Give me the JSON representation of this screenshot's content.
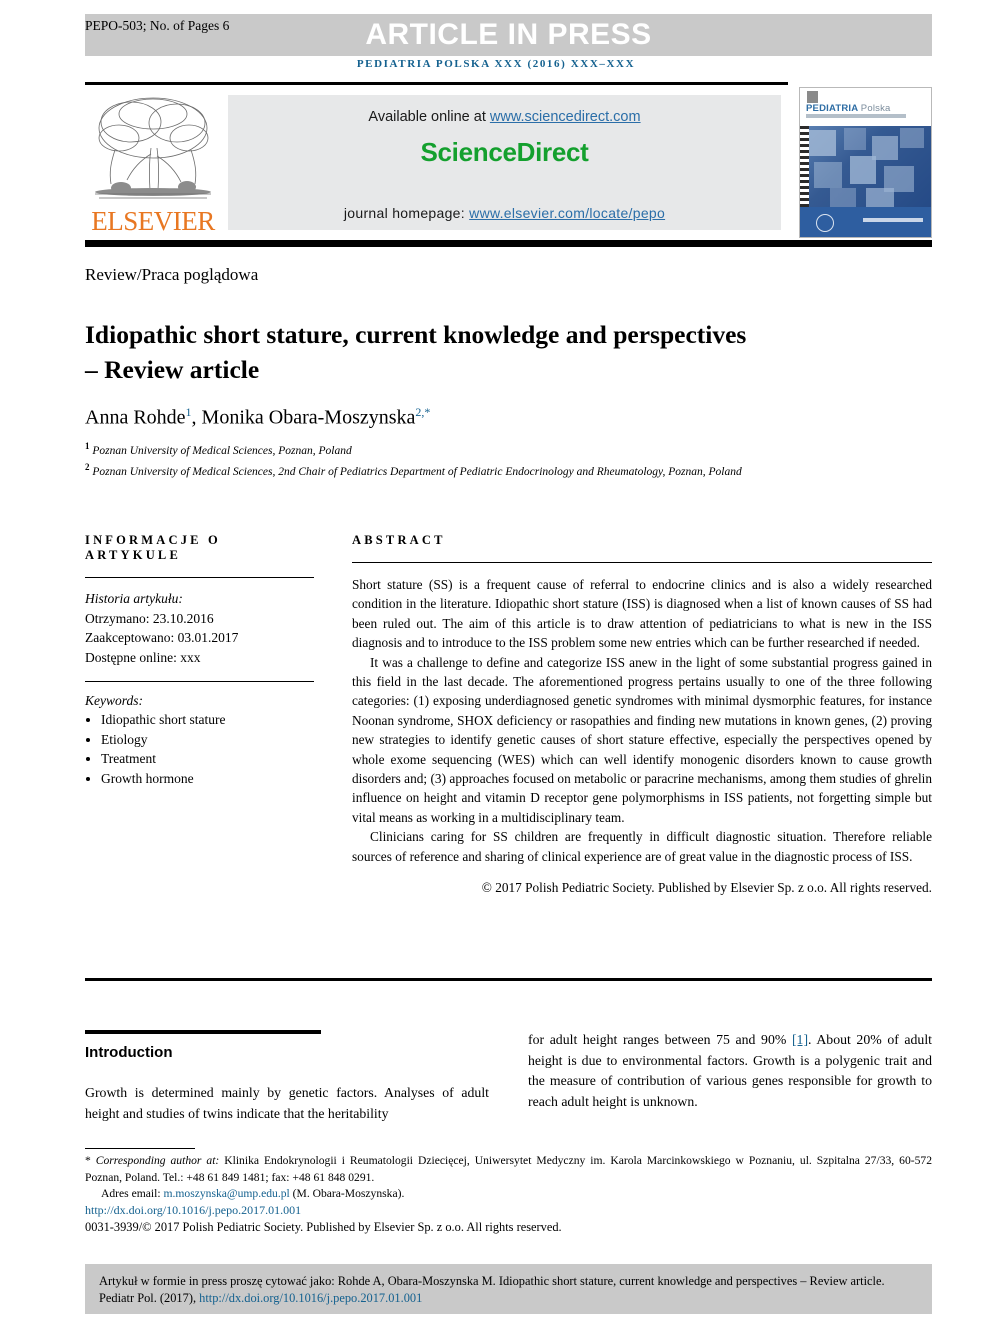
{
  "header": {
    "running_id": "PEPO-503; No. of Pages 6",
    "press_banner": "ARTICLE IN PRESS",
    "journal_citation_line": "PEDIATRIA POLSKA XXX (2016) XXX–XXX"
  },
  "masthead": {
    "publisher_name": "ELSEVIER",
    "available_prefix": "Available online at ",
    "available_url": "www.sciencedirect.com",
    "sciencedirect_logo": "ScienceDirect",
    "homepage_prefix": "journal homepage: ",
    "homepage_url": "www.elsevier.com/locate/pepo",
    "cover": {
      "title_main": "PEDIATRIA",
      "title_secondary": "Polska"
    },
    "colors": {
      "sciencedirect_green": "#14a02e",
      "link_blue": "#2b6ea8",
      "elsevier_orange": "#e87722",
      "banner_gray": "#c9c9c9"
    }
  },
  "article": {
    "kicker": "Review/Praca poglądowa",
    "title": "Idiopathic short stature, current knowledge and perspectives – Review article",
    "authors": [
      {
        "name": "Anna Rohde",
        "sup": "1"
      },
      {
        "name": "Monika Obara-Moszynska",
        "sup": "2,*"
      }
    ],
    "authors_line_separator": ", ",
    "affiliations": [
      {
        "marker": "1",
        "text": "Poznan University of Medical Sciences, Poznan, Poland"
      },
      {
        "marker": "2",
        "text": "Poznan University of Medical Sciences, 2nd Chair of Pediatrics Department of Pediatric Endocrinology and Rheumatology, Poznan, Poland"
      }
    ]
  },
  "article_info": {
    "heading": "INFORMACJE O ARTYKULE",
    "history_label": "Historia artykułu:",
    "history": [
      "Otrzymano: 23.10.2016",
      "Zaakceptowano: 03.01.2017",
      "Dostępne online: xxx"
    ],
    "keywords_label": "Keywords:",
    "keywords": [
      "Idiopathic short stature",
      "Etiology",
      "Treatment",
      "Growth hormone"
    ]
  },
  "abstract": {
    "heading": "ABSTRACT",
    "paragraphs": [
      "Short stature (SS) is a frequent cause of referral to endocrine clinics and is also a widely researched condition in the literature. Idiopathic short stature (ISS) is diagnosed when a list of known causes of SS had been ruled out. The aim of this article is to draw attention of pediatricians to what is new in the ISS diagnosis and to introduce to the ISS problem some new entries which can be further researched if needed.",
      "It was a challenge to define and categorize ISS anew in the light of some substantial progress gained in this field in the last decade. The aforementioned progress pertains usually to one of the three following categories: (1) exposing underdiagnosed genetic syndromes with minimal dysmorphic features, for instance Noonan syndrome, SHOX deficiency or rasopathies and finding new mutations in known genes, (2) proving new strategies to identify genetic causes of short stature effective, especially the perspectives opened by whole exome sequencing (WES) which can well identify monogenic disorders known to cause growth disorders and; (3) approaches focused on metabolic or paracrine mechanisms, among them studies of ghrelin influence on height and vitamin D receptor gene polymorphisms in ISS patients, not forgetting simple but vital means as working in a multidisciplinary team.",
      "Clinicians caring for SS children are frequently in difficult diagnostic situation. Therefore reliable sources of reference and sharing of clinical experience are of great value in the diagnostic process of ISS."
    ],
    "copyright": "© 2017 Polish Pediatric Society. Published by Elsevier Sp. z o.o. All rights reserved."
  },
  "body": {
    "introduction_heading": "Introduction",
    "left_column_text": "Growth is determined mainly by genetic factors. Analyses of adult height and studies of twins indicate that the heritability",
    "right_column_text_before_ref": "for adult height ranges between 75 and 90% ",
    "right_column_reference": "[1]",
    "right_column_text_after_ref": ". About 20% of adult height is due to environmental factors. Growth is a polygenic trait and the measure of contribution of various genes responsible for growth to reach adult height is unknown."
  },
  "footnote": {
    "marker": "*",
    "corresponding_label": "Corresponding author at:",
    "corresponding_text": " Klinika Endokrynologii i Reumatologii Dziecięcej, Uniwersytet Medyczny im. Karola Marcinkowskiego w Poznaniu, ul. Szpitalna 27/33, 60-572 Poznan, Poland. Tel.: +48 61 849 1481; fax: +48 61 848 0291.",
    "email_label": "Adres email: ",
    "email": "m.moszynska@ump.edu.pl",
    "email_suffix": " (M. Obara-Moszynska).",
    "doi": "http://dx.doi.org/10.1016/j.pepo.2017.01.001",
    "issn_copyright": "0031-3939/© 2017 Polish Pediatric Society. Published by Elsevier Sp. z o.o. All rights reserved."
  },
  "citation_box": {
    "text_before_link": "Artykuł w formie in press proszę cytować jako: Rohde  A, Obara-Moszynska  M. Idiopathic short stature, current knowledge and perspectives – Review article. Pediatr Pol. (2017), ",
    "link": "http://dx.doi.org/10.1016/j.pepo.2017.01.001"
  }
}
